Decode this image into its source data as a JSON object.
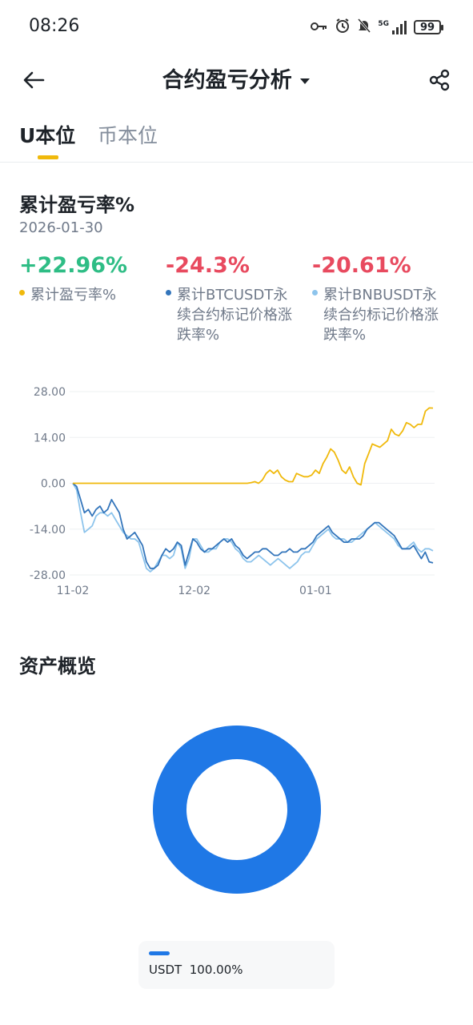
{
  "status_bar": {
    "time": "08:26",
    "network": "5G",
    "battery": "99"
  },
  "header": {
    "title": "合约盈亏分析"
  },
  "tabs": [
    {
      "label": "U本位",
      "active": true
    },
    {
      "label": "币本位",
      "active": false
    }
  ],
  "pnl_section": {
    "title": "累计盈亏率%",
    "date": "2026-01-30",
    "metrics": [
      {
        "value": "+22.96%",
        "label": "累计盈亏率%",
        "color": "#2ebd85",
        "dot_color": "#f0b90b"
      },
      {
        "value": "-24.3%",
        "label": "累计BTCUSDT永续合约标记价格涨跌率%",
        "label_line1": "累计BTCUSDT永",
        "label_line2": "续合约标记价格涨",
        "label_line3": "跌率%",
        "color": "#e84a5f",
        "dot_color": "#3375bb"
      },
      {
        "value": "-20.61%",
        "label": "累计BNBUSDT永续合约标记价格涨跌率%",
        "label_line1": "累计BNBUSDT永",
        "label_line2": "续合约标记价格涨",
        "label_line3": "跌率%",
        "color": "#e84a5f",
        "dot_color": "#8dc4ec"
      }
    ]
  },
  "chart_data": {
    "type": "line",
    "y_ticks": [
      "28.00",
      "14.00",
      "0.00",
      "-14.00",
      "-28.00"
    ],
    "ylim": [
      -28,
      28
    ],
    "x_ticks": [
      {
        "label": "11-02",
        "index": 0
      },
      {
        "label": "12-02",
        "index": 30
      },
      {
        "label": "01-01",
        "index": 60
      }
    ],
    "x_count": 90,
    "grid": true,
    "series": [
      {
        "name": "累计盈亏率%",
        "color": "#f0b90b",
        "values": [
          0,
          0,
          0,
          0,
          0,
          0,
          0,
          0,
          0,
          0,
          0,
          0,
          0,
          0,
          0,
          0,
          0,
          0,
          0,
          0,
          0,
          0,
          0,
          0,
          0,
          0,
          0,
          0,
          0,
          0,
          0,
          0,
          0,
          0,
          0,
          0,
          0,
          0,
          0,
          0,
          0,
          0,
          0,
          0,
          0,
          0,
          0,
          0.2,
          0.5,
          0,
          1,
          3,
          4,
          3,
          4,
          2,
          1,
          0.5,
          0.5,
          3,
          2.5,
          2,
          2,
          2.5,
          4,
          3,
          6,
          8,
          10.5,
          9.5,
          7,
          4,
          3,
          5,
          2,
          0,
          -0.5,
          6,
          9,
          12,
          11.5,
          11,
          12,
          13,
          16.5,
          15,
          14.5,
          16,
          18.5,
          18,
          17,
          18,
          18,
          22,
          23,
          22.96
        ]
      },
      {
        "name": "累计BTCUSDT永续合约标记价格涨跌率%",
        "color": "#3375bb",
        "values": [
          0,
          -1,
          -5,
          -9,
          -8,
          -10,
          -8,
          -7,
          -9,
          -8,
          -5,
          -7,
          -9,
          -14,
          -17,
          -16,
          -15,
          -17,
          -19,
          -24,
          -26,
          -26,
          -25,
          -22,
          -20,
          -21,
          -20,
          -18,
          -19,
          -25,
          -21,
          -17,
          -18,
          -20,
          -21,
          -20,
          -20,
          -19,
          -18,
          -17,
          -18,
          -17,
          -19,
          -20,
          -22,
          -23,
          -22,
          -21,
          -21,
          -20,
          -20,
          -21,
          -22,
          -22,
          -21,
          -21,
          -20,
          -21,
          -21,
          -20,
          -20,
          -19,
          -18,
          -16,
          -15,
          -14,
          -13,
          -15,
          -16,
          -17,
          -18,
          -18,
          -17,
          -17,
          -17,
          -16,
          -14,
          -13,
          -12,
          -12,
          -13,
          -14,
          -15,
          -16,
          -18,
          -20,
          -20,
          -20,
          -19,
          -21,
          -23,
          -21,
          -24,
          -24.3
        ]
      },
      {
        "name": "累计BNBUSDT永续合约标记价格涨跌率%",
        "color": "#8dc4ec",
        "values": [
          0,
          -2,
          -9,
          -15,
          -14,
          -13,
          -10,
          -9,
          -9,
          -10,
          -9,
          -11,
          -13,
          -15,
          -16,
          -17,
          -17,
          -18,
          -22,
          -26,
          -27,
          -26,
          -24,
          -22,
          -22,
          -23,
          -22,
          -18,
          -20,
          -26,
          -23,
          -17,
          -17,
          -19,
          -21,
          -21,
          -20,
          -20,
          -18,
          -17,
          -17,
          -18,
          -20,
          -21,
          -23,
          -24,
          -24,
          -23,
          -22,
          -23,
          -24,
          -25,
          -24,
          -23,
          -24,
          -25,
          -26,
          -25,
          -24,
          -22,
          -21,
          -21,
          -19,
          -17,
          -16,
          -15,
          -14,
          -16,
          -17,
          -17,
          -17,
          -18,
          -18,
          -17,
          -16,
          -15,
          -14,
          -13,
          -12,
          -13,
          -14,
          -15,
          -16,
          -17,
          -19,
          -20,
          -20,
          -19,
          -18,
          -20,
          -21,
          -20,
          -20,
          -20.61
        ]
      }
    ]
  },
  "asset_section": {
    "title": "资产概览",
    "donut": {
      "type": "pie",
      "slices": [
        {
          "label": "USDT",
          "percent": 100.0,
          "color": "#1f78e6"
        }
      ]
    },
    "legend": {
      "asset": "USDT",
      "percent": "100.00%"
    }
  }
}
